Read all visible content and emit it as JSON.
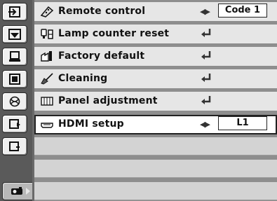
{
  "sidebar": {
    "items": [
      {
        "name": "input-icon"
      },
      {
        "name": "picture-adjust-icon"
      },
      {
        "name": "screen-icon"
      },
      {
        "name": "image-select-icon"
      },
      {
        "name": "color-adjust-icon"
      },
      {
        "name": "setting-icon"
      },
      {
        "name": "expand-icon"
      },
      {
        "name": "projector-icon",
        "active": true
      }
    ]
  },
  "menu": {
    "items": [
      {
        "label": "Remote control",
        "icon": "remote-icon",
        "control": "select",
        "value": "Code 1"
      },
      {
        "label": "Lamp counter reset",
        "icon": "lamp-icon",
        "control": "enter"
      },
      {
        "label": "Factory default",
        "icon": "factory-icon",
        "control": "enter"
      },
      {
        "label": "Cleaning",
        "icon": "cleaning-icon",
        "control": "enter"
      },
      {
        "label": "Panel adjustment",
        "icon": "panel-icon",
        "control": "enter"
      },
      {
        "label": "HDMI setup",
        "icon": "hdmi-icon",
        "control": "select",
        "value": "L1"
      }
    ],
    "selected_index": 5
  },
  "symbols": {
    "left_right": "◀▶",
    "up_arrow": "↑",
    "sidebar_arrow": "▶"
  },
  "colors": {
    "sidebar_bg": "#5a5a5a",
    "row_bg": "#e6e6e6",
    "empty_row_bg": "#d3d3d3",
    "active_row_bg": "#ffffff"
  }
}
